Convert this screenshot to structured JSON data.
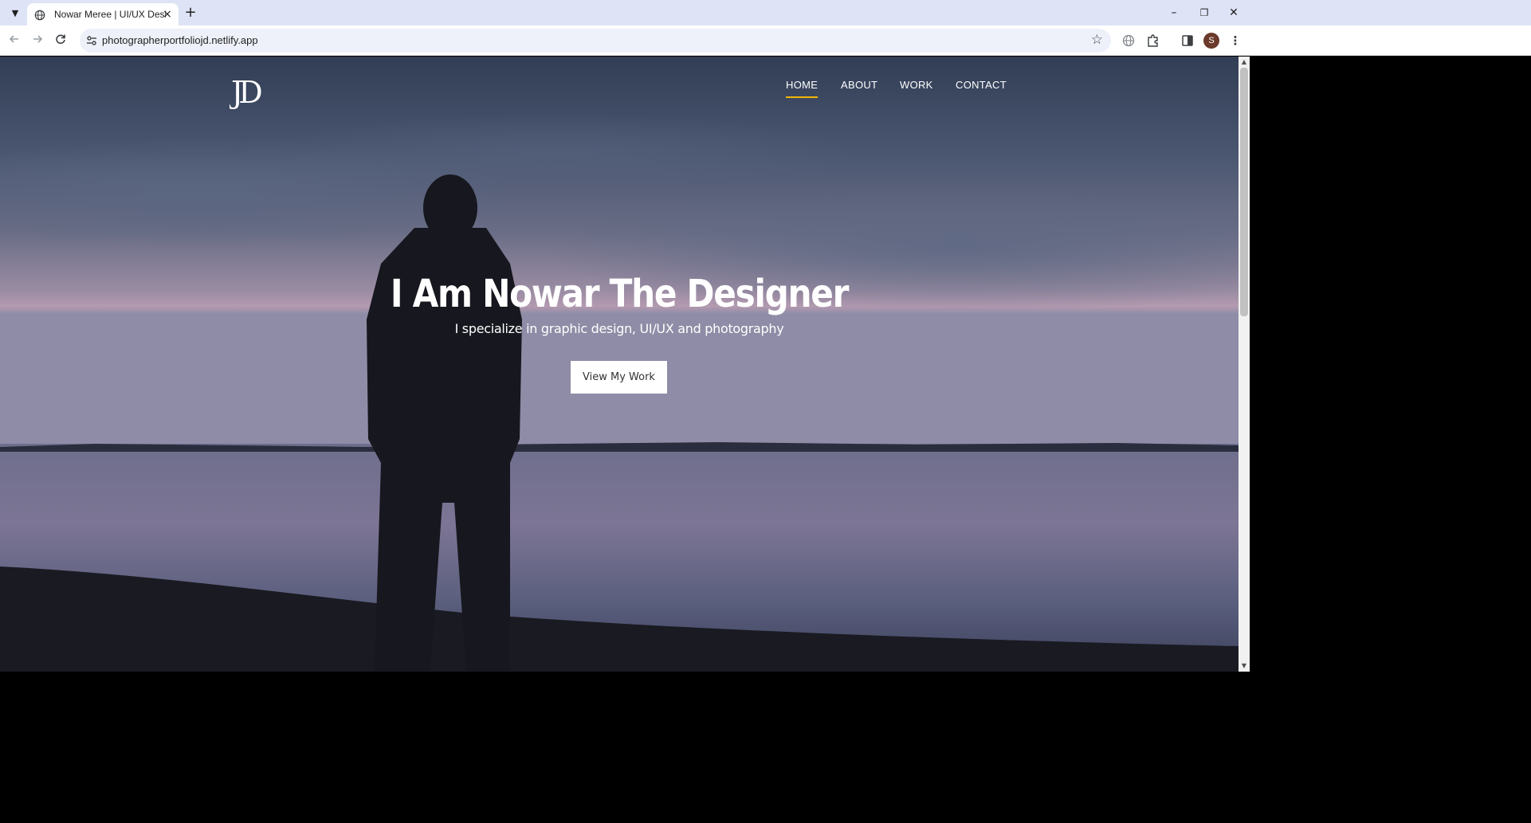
{
  "browser": {
    "tab": {
      "title": "Nowar Meree | UI/UX Designer",
      "close_icon": "×"
    },
    "new_tab_icon": "+",
    "url": "photographerportfoliojd.netlify.app",
    "window_controls": {
      "minimize": "–",
      "restore": "❐",
      "close": "✕"
    },
    "profile_initial": "S"
  },
  "site": {
    "logo_text": "JD",
    "nav": [
      {
        "label": "HOME",
        "active": true
      },
      {
        "label": "ABOUT",
        "active": false
      },
      {
        "label": "WORK",
        "active": false
      },
      {
        "label": "CONTACT",
        "active": false
      }
    ],
    "hero": {
      "title": "I Am Nowar The Designer",
      "subtitle": "I specialize in graphic design, UI/UX and photography",
      "cta_label": "View My Work"
    },
    "colors": {
      "accent": "#f2b705",
      "text": "#ffffff"
    }
  }
}
